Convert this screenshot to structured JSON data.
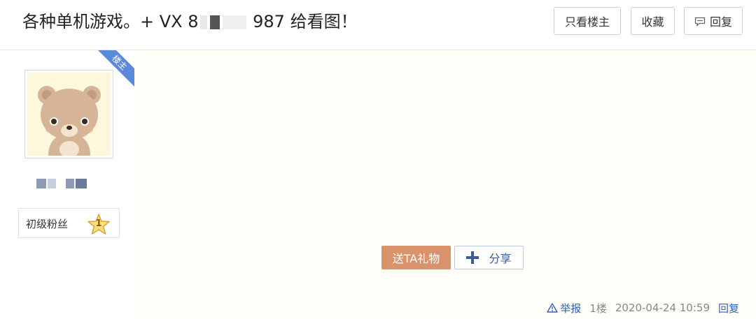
{
  "header": {
    "title_prefix": "各种单机游戏。+ VX 8",
    "title_suffix": "987 给看图！",
    "buttons": {
      "only_author": "只看楼主",
      "favorite": "收藏",
      "reply": "回复"
    }
  },
  "author": {
    "floor_owner_tag": "楼主",
    "level_title": "初级粉丝",
    "level_number": "1"
  },
  "post": {
    "gift_button": "送TA礼物",
    "share_button": "分享",
    "report_link": "举报",
    "floor_label": "1楼",
    "timestamp": "2020-04-24 10:59",
    "reply_link": "回复"
  },
  "colors": {
    "ribbon": "#5b8ad8",
    "gift_button": "#d9926a",
    "link": "#2d64b3",
    "share_border": "#b9cbe6"
  },
  "icons": {
    "reply": "comment-icon",
    "share": "plus-icon",
    "report": "warning-triangle-icon",
    "level": "star-icon"
  }
}
